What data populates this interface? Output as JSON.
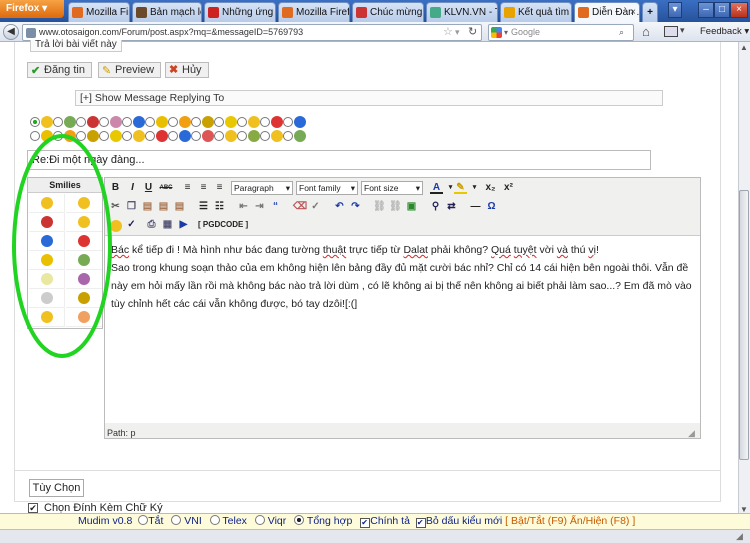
{
  "browser": {
    "menu_label": "Firefox",
    "tabs": [
      {
        "label": "Mozilla Firefo...",
        "color": "#e06b1f"
      },
      {
        "label": "Bản mạch lo...",
        "color": "#6a4a2a"
      },
      {
        "label": "Những ứng d...",
        "color": "#c22"
      },
      {
        "label": "Mozilla Firefo...",
        "color": "#e06b1f"
      },
      {
        "label": "Chúc mừng si...",
        "color": "#c33"
      },
      {
        "label": "KLVN.VN - Tr...",
        "color": "#4a8"
      },
      {
        "label": "Kết quả tìm ki...",
        "color": "#e8a300"
      },
      {
        "label": "Diễn Đàn ...",
        "color": "#e06b1f"
      }
    ],
    "url": "www.otosaigon.com/Forum/post.aspx?mq=&messageID=5769793",
    "search_placeholder": "Google",
    "feedback_label": "Feedback"
  },
  "form": {
    "header_label": "Trả lời bài viết này",
    "post_button": "Đăng tin",
    "preview_button": "Preview",
    "cancel_button": "Hủy",
    "show_reply_label": "[+] Show Message Replying To",
    "subject_value": "Re:Đi một ngày đàng...",
    "smilies_title": "Smilies",
    "toolbar": {
      "bold": "B",
      "italic": "I",
      "underline": "U",
      "strike": "ABC",
      "paragraph": "Paragraph",
      "font_family": "Font family",
      "font_size": "Font size",
      "subscript": "x₂",
      "superscript": "x²",
      "pgdcode": "[ PGDCODE ]"
    },
    "editor_lines": [
      "Bác kể tiếp đi ! Mà hình như bác đang tường thuật trực tiếp từ Dalat phải không? Quá tuyệt vời và thú vị!",
      "Sao trong khung soạn thảo của em không hiện lên bảng đầy đủ mặt cười bác nhỉ? Chỉ có 14 cái hiện bên ngoài thôi. Vẫn đề",
      "này em hỏi mấy lần rồi mà không bác nào trả lời dùm , có lẽ không ai bị thế nên không ai biết phải làm sao...? Em đã mò vào",
      "tùy chỉnh hết các cái vẫn không được, bó tay dzôi![:(]"
    ],
    "path_label": "Path: p",
    "options_tab": "Tùy Chọn",
    "signature_label": "Chọn Đính Kèm Chữ Ký"
  },
  "mudim": {
    "title": "Mudim",
    "version": "v0.8",
    "modes": [
      "Tắt",
      "VNI",
      "Telex",
      "Viqr",
      "Tổng hợp"
    ],
    "selected_mode": "Tổng hợp",
    "spell_check": "Chính tả",
    "remove_accent": "Bỏ dấu kiểu mới",
    "toggle_text": "[ Bật/Tắt (F9) Ẩn/Hiện (F8) ]"
  },
  "colors": {
    "tabbar": "#27529a",
    "green_annotation": "#22d422",
    "link_orange": "#c85a00"
  }
}
